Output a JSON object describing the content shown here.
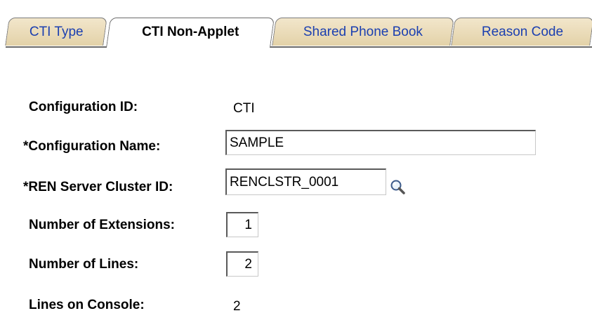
{
  "tabs": [
    {
      "label": "CTI Type",
      "active": false
    },
    {
      "label": "CTI Non-Applet",
      "active": true
    },
    {
      "label": "Shared Phone Book",
      "active": false
    },
    {
      "label": "Reason Code",
      "active": false
    }
  ],
  "form": {
    "configuration_id_label": "Configuration ID:",
    "configuration_id_value": "CTI",
    "configuration_name_label": "*Configuration Name:",
    "configuration_name_value": "SAMPLE",
    "ren_cluster_label": "*REN Server Cluster ID:",
    "ren_cluster_value": "RENCLSTR_0001",
    "extensions_label": "Number of Extensions:",
    "extensions_value": "1",
    "lines_label": "Number of Lines:",
    "lines_value": "2",
    "lines_on_console_label": "Lines on Console:",
    "lines_on_console_value": "2"
  },
  "colors": {
    "tab_link": "#1b3fb0",
    "tab_background": "#e3d2a8"
  },
  "icons": {
    "lookup": "magnifier-icon"
  }
}
